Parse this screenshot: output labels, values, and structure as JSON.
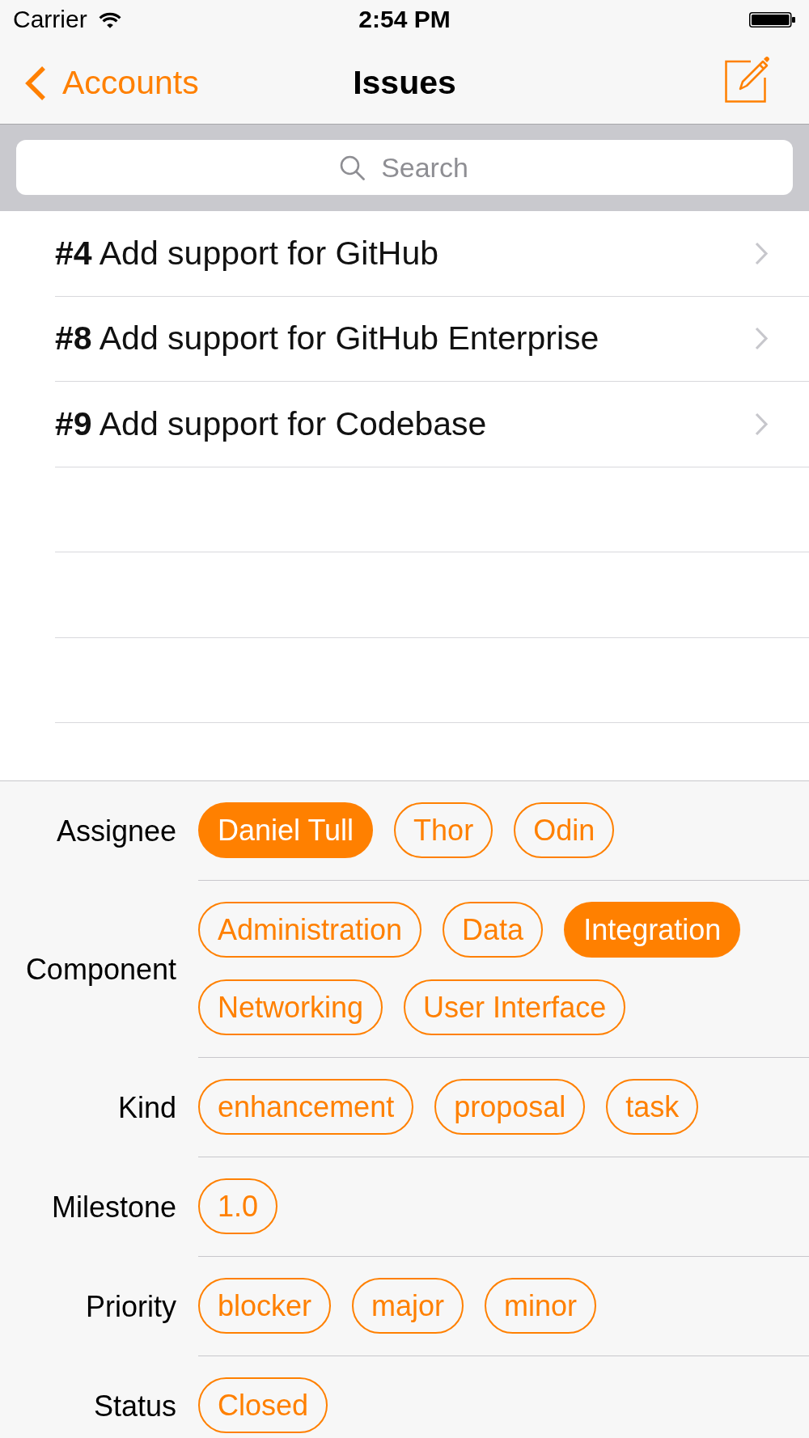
{
  "status_bar": {
    "carrier": "Carrier",
    "time": "2:54 PM"
  },
  "nav_bar": {
    "back_label": "Accounts",
    "title": "Issues"
  },
  "search": {
    "placeholder": "Search"
  },
  "issues": [
    {
      "title": "**#4** Add support for GitHub"
    },
    {
      "title": "**#8** Add support for GitHub Enterprise"
    },
    {
      "title": "**#9** Add support for Codebase"
    }
  ],
  "filters": [
    {
      "label": "Assignee",
      "options": [
        {
          "label": "Daniel Tull",
          "selected": true
        },
        {
          "label": "Thor",
          "selected": false
        },
        {
          "label": "Odin",
          "selected": false
        }
      ]
    },
    {
      "label": "Component",
      "options": [
        {
          "label": "Administration",
          "selected": false
        },
        {
          "label": "Data",
          "selected": false
        },
        {
          "label": "Integration",
          "selected": true
        },
        {
          "label": "Networking",
          "selected": false
        },
        {
          "label": "User Interface",
          "selected": false
        }
      ]
    },
    {
      "label": "Kind",
      "options": [
        {
          "label": "enhancement",
          "selected": false
        },
        {
          "label": "proposal",
          "selected": false
        },
        {
          "label": "task",
          "selected": false
        }
      ]
    },
    {
      "label": "Milestone",
      "options": [
        {
          "label": "1.0",
          "selected": false
        }
      ]
    },
    {
      "label": "Priority",
      "options": [
        {
          "label": "blocker",
          "selected": false
        },
        {
          "label": "major",
          "selected": false
        },
        {
          "label": "minor",
          "selected": false
        }
      ]
    },
    {
      "label": "Status",
      "options": [
        {
          "label": "Closed",
          "selected": false
        }
      ]
    }
  ]
}
